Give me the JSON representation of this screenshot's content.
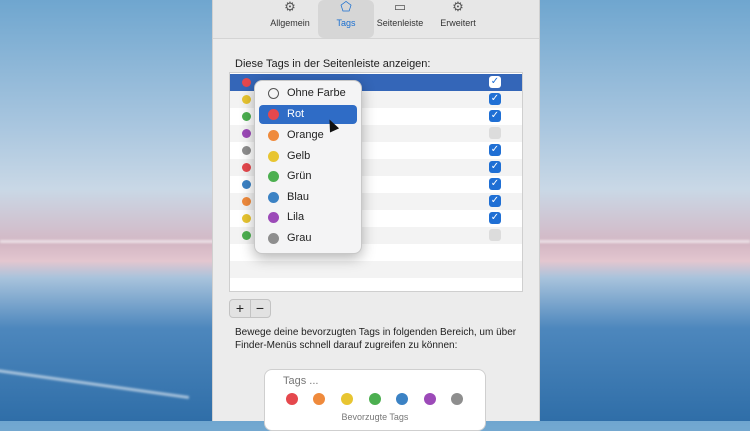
{
  "toolbar": {
    "items": [
      {
        "label": "Allgemein",
        "icon": "gear-icon"
      },
      {
        "label": "Tags",
        "icon": "tag-icon"
      },
      {
        "label": "Seitenleiste",
        "icon": "sidebar-icon"
      },
      {
        "label": "Erweitert",
        "icon": "gears-icon"
      }
    ],
    "active": "Tags"
  },
  "tags_section": {
    "label": "Diese Tags in der Seitenleiste anzeigen:",
    "rows": [
      {
        "color": "#e5484d",
        "checked": true,
        "selected": true
      },
      {
        "color": "#e8c531",
        "checked": true
      },
      {
        "color": "#4caf50",
        "checked": true
      },
      {
        "color": "#9c4ab8",
        "checked": false
      },
      {
        "color": "#8e8e8e",
        "checked": true
      },
      {
        "color": "#e5484d",
        "checked": true
      },
      {
        "color": "#3b82c4",
        "checked": true
      },
      {
        "color": "#ef8a3c",
        "checked": true
      },
      {
        "color": "#e8c531",
        "checked": true
      },
      {
        "color": "#4caf50",
        "checked": false
      }
    ]
  },
  "color_menu": {
    "items": [
      {
        "label": "Ohne Farbe",
        "color": "none"
      },
      {
        "label": "Rot",
        "color": "#e5484d",
        "highlighted": true
      },
      {
        "label": "Orange",
        "color": "#ef8a3c"
      },
      {
        "label": "Gelb",
        "color": "#e8c531"
      },
      {
        "label": "Grün",
        "color": "#4caf50"
      },
      {
        "label": "Blau",
        "color": "#3b82c4"
      },
      {
        "label": "Lila",
        "color": "#9c4ab8"
      },
      {
        "label": "Grau",
        "color": "#8e8e8e"
      }
    ]
  },
  "buttons": {
    "add": "+",
    "remove": "−"
  },
  "hint": "Bewege deine bevorzugten Tags in folgenden Bereich, um über Finder-Menüs schnell darauf zugreifen zu können:",
  "favorites": {
    "title": "Tags ...",
    "colors": [
      "#e5484d",
      "#ef8a3c",
      "#e8c531",
      "#4caf50",
      "#3b82c4",
      "#9c4ab8",
      "#8e8e8e"
    ],
    "footer": "Bevorzugte Tags"
  }
}
